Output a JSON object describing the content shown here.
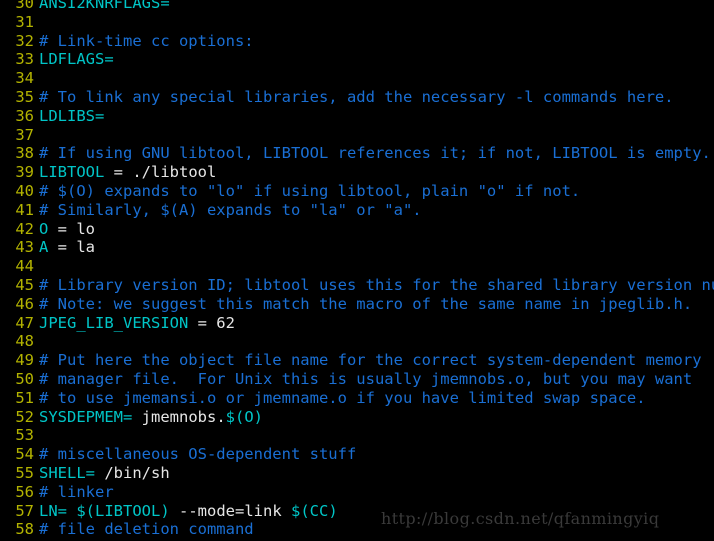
{
  "app": {
    "kind": "terminal-code-viewer",
    "background": "#000000",
    "colors": {
      "gutter": "#b3b300",
      "comment": "#1a6fd4",
      "variable": "#00c5c7",
      "plain": "#e6e6e6",
      "watermark": "#3a3a3a"
    }
  },
  "watermark": {
    "text": "http://blog.csdn.net/qfanmingyiq"
  },
  "code": {
    "first_line_number": 30,
    "lines": [
      {
        "no": "30",
        "tokens": [
          {
            "t": "var",
            "s": "ANSI2KNRFLAGS="
          }
        ]
      },
      {
        "no": "31",
        "tokens": []
      },
      {
        "no": "32",
        "tokens": [
          {
            "t": "cmt",
            "s": "# Link-time cc options:"
          }
        ]
      },
      {
        "no": "33",
        "tokens": [
          {
            "t": "var",
            "s": "LDFLAGS="
          }
        ]
      },
      {
        "no": "34",
        "tokens": []
      },
      {
        "no": "35",
        "tokens": [
          {
            "t": "cmt",
            "s": "# To link any special libraries, add the necessary -l commands here."
          }
        ]
      },
      {
        "no": "36",
        "tokens": [
          {
            "t": "var",
            "s": "LDLIBS="
          }
        ]
      },
      {
        "no": "37",
        "tokens": []
      },
      {
        "no": "38",
        "tokens": [
          {
            "t": "cmt",
            "s": "# If using GNU libtool, LIBTOOL references it; if not, LIBTOOL is empty."
          }
        ]
      },
      {
        "no": "39",
        "tokens": [
          {
            "t": "var",
            "s": "LIBTOOL"
          },
          {
            "t": "txt",
            "s": " = ./libtool"
          }
        ]
      },
      {
        "no": "40",
        "tokens": [
          {
            "t": "cmt",
            "s": "# $(O) expands to \"lo\" if using libtool, plain \"o\" if not."
          }
        ]
      },
      {
        "no": "41",
        "tokens": [
          {
            "t": "cmt",
            "s": "# Similarly, $(A) expands to \"la\" or \"a\"."
          }
        ]
      },
      {
        "no": "42",
        "tokens": [
          {
            "t": "var",
            "s": "O"
          },
          {
            "t": "txt",
            "s": " = lo"
          }
        ]
      },
      {
        "no": "43",
        "tokens": [
          {
            "t": "var",
            "s": "A"
          },
          {
            "t": "txt",
            "s": " = la"
          }
        ]
      },
      {
        "no": "44",
        "tokens": []
      },
      {
        "no": "45",
        "tokens": [
          {
            "t": "cmt",
            "s": "# Library version ID; libtool uses this for the shared library version numb"
          }
        ]
      },
      {
        "no": "46",
        "tokens": [
          {
            "t": "cmt",
            "s": "# Note: we suggest this match the macro of the same name in jpeglib.h."
          }
        ]
      },
      {
        "no": "47",
        "tokens": [
          {
            "t": "var",
            "s": "JPEG_LIB_VERSION"
          },
          {
            "t": "txt",
            "s": " = 62"
          }
        ]
      },
      {
        "no": "48",
        "tokens": []
      },
      {
        "no": "49",
        "tokens": [
          {
            "t": "cmt",
            "s": "# Put here the object file name for the correct system-dependent memory"
          }
        ]
      },
      {
        "no": "50",
        "tokens": [
          {
            "t": "cmt",
            "s": "# manager file.  For Unix this is usually jmemnobs.o, but you may want"
          }
        ]
      },
      {
        "no": "51",
        "tokens": [
          {
            "t": "cmt",
            "s": "# to use jmemansi.o or jmemname.o if you have limited swap space."
          }
        ]
      },
      {
        "no": "52",
        "tokens": [
          {
            "t": "var",
            "s": "SYSDEPMEM="
          },
          {
            "t": "txt",
            "s": " jmemnobs."
          },
          {
            "t": "var",
            "s": "$(O)"
          }
        ]
      },
      {
        "no": "53",
        "tokens": []
      },
      {
        "no": "54",
        "tokens": [
          {
            "t": "cmt",
            "s": "# miscellaneous OS-dependent stuff"
          }
        ]
      },
      {
        "no": "55",
        "tokens": [
          {
            "t": "var",
            "s": "SHELL="
          },
          {
            "t": "txt",
            "s": " /bin/sh"
          }
        ]
      },
      {
        "no": "56",
        "tokens": [
          {
            "t": "cmt",
            "s": "# linker"
          }
        ]
      },
      {
        "no": "57",
        "tokens": [
          {
            "t": "var",
            "s": "LN="
          },
          {
            "t": "txt",
            "s": " "
          },
          {
            "t": "var",
            "s": "$(LIBTOOL)"
          },
          {
            "t": "txt",
            "s": " --mode=link "
          },
          {
            "t": "var",
            "s": "$(CC)"
          }
        ]
      },
      {
        "no": "58",
        "tokens": [
          {
            "t": "cmt",
            "s": "# file deletion command"
          }
        ]
      }
    ]
  }
}
